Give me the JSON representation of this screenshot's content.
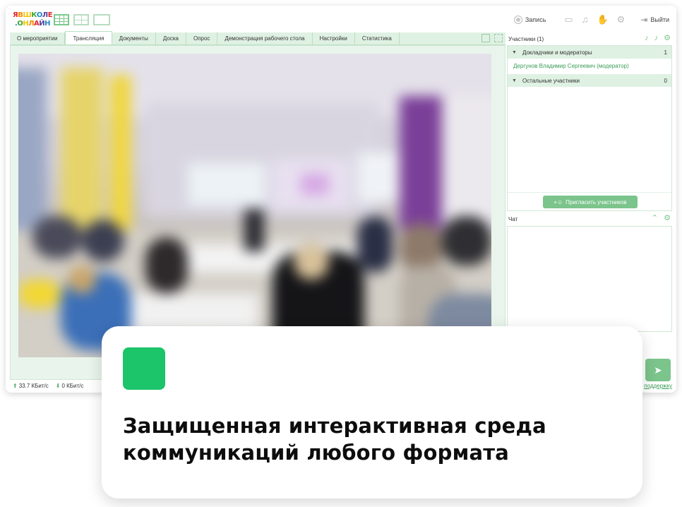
{
  "logo": {
    "line1": "ЯВШКОЛЕ",
    "line2": ".ОНЛАЙН"
  },
  "toolbar": {
    "record_label": "Запись",
    "exit_label": "Выйти"
  },
  "tabs": [
    {
      "label": "О мероприятии",
      "active": false
    },
    {
      "label": "Трансляция",
      "active": true
    },
    {
      "label": "Документы",
      "active": false
    },
    {
      "label": "Доска",
      "active": false
    },
    {
      "label": "Опрос",
      "active": false
    },
    {
      "label": "Демонстрация рабочего стола",
      "active": false
    },
    {
      "label": "Настройки",
      "active": false
    },
    {
      "label": "Статистика",
      "active": false
    }
  ],
  "participants": {
    "title": "Участники (1)",
    "groups": [
      {
        "label": "Докладчики и модераторы",
        "count": "1",
        "members": [
          "Дергунов Владимир Сергеевич (модератор)"
        ]
      },
      {
        "label": "Остальные участники",
        "count": "0",
        "members": []
      }
    ],
    "invite_label": "Пригласить участников"
  },
  "chat": {
    "title": "Чат"
  },
  "status": {
    "upload": "33.7 КБит/с",
    "download": "0 КБит/с",
    "support": "поддержку"
  },
  "card": {
    "line1": "Защищенная интерактивная среда",
    "line2": "коммуникаций любого формата",
    "accent_color": "#1cc46a"
  },
  "colors": {
    "accent": "#7bc48b",
    "tab_bg": "#dff1e3",
    "link": "#3a9c57"
  }
}
